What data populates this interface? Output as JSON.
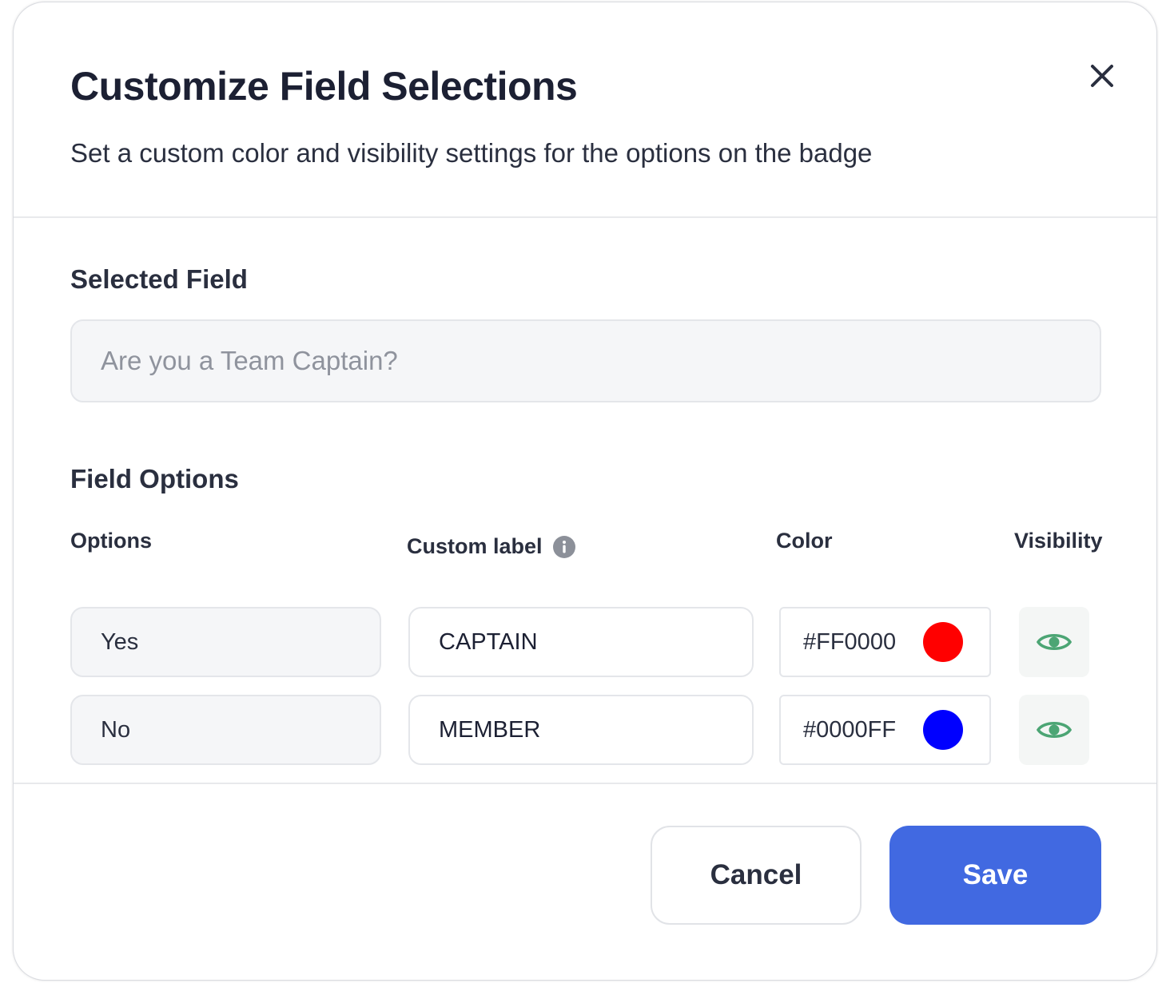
{
  "dialog": {
    "title": "Customize Field Selections",
    "subtitle": "Set a custom color and visibility settings for the options on the badge"
  },
  "selected_field": {
    "label": "Selected Field",
    "placeholder": "Are you a Team Captain?"
  },
  "field_options": {
    "label": "Field Options",
    "columns": {
      "options": "Options",
      "custom_label": "Custom label",
      "color": "Color",
      "visibility": "Visibility"
    },
    "rows": [
      {
        "option": "Yes",
        "custom_label": "CAPTAIN",
        "color_hex": "#FF0000",
        "swatch_color": "#FF0000",
        "visibility_icon": "eye-icon"
      },
      {
        "option": "No",
        "custom_label": "MEMBER",
        "color_hex": "#0000FF",
        "swatch_color": "#0000FF",
        "visibility_icon": "eye-icon"
      }
    ]
  },
  "footer": {
    "cancel_label": "Cancel",
    "save_label": "Save"
  },
  "colors": {
    "primary": "#4169E1",
    "visibility_icon": "#4CA574"
  }
}
